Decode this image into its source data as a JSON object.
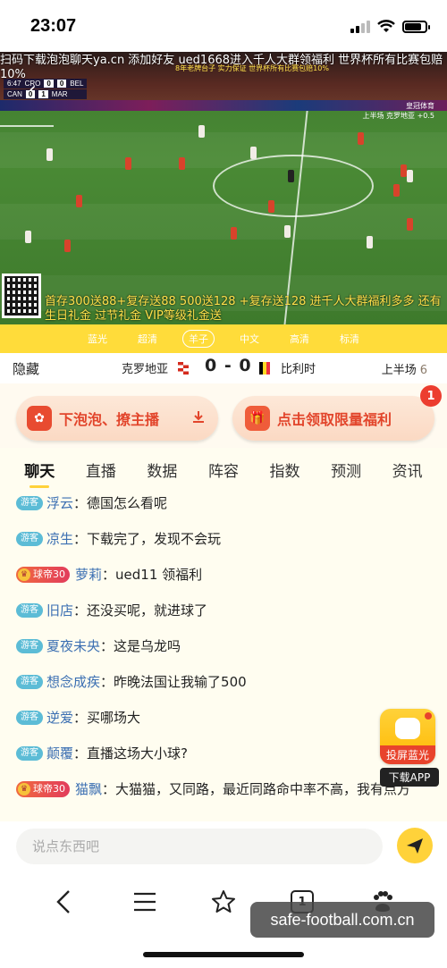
{
  "status_bar": {
    "time": "23:07"
  },
  "video": {
    "marquee": "扫码下载泡泡聊天ya.cn 添加好友 ued1668进入千人大群领福利 世界杯所有比赛包赔10%",
    "score_rows": [
      {
        "clock": "6:47",
        "home": "CRO",
        "home_score": "0",
        "away_score": "0",
        "away": "BEL"
      },
      {
        "clock": "",
        "home": "CAN",
        "home_score": "0",
        "away_score": "1",
        "away": "MAR"
      }
    ],
    "promo_top": "8年老牌台子 实力保证 世界杯所有比赛包赔10%",
    "promo_right_1": "皇冠体育",
    "promo_right_2": "上半场 克罗地亚 +0.5",
    "promo_bottom": "首存300送88+复存送88 500送128 +复存送128 进千人大群福利多多 还有生日礼金 过节礼金 VIP等级礼金送"
  },
  "quality_options": [
    "蓝光",
    "超清",
    "羊子",
    "中文",
    "高清",
    "标清"
  ],
  "quality_active": 2,
  "match": {
    "hide_label": "隐藏",
    "home": "克罗地亚",
    "away": "比利时",
    "score": "0 - 0",
    "period": "上半场",
    "minute": "6"
  },
  "actions": {
    "download_label": "下泡泡、撩主播",
    "welfare_label": "点击领取限量福利",
    "welfare_badge": "1"
  },
  "tabs": [
    "聊天",
    "直播",
    "数据",
    "阵容",
    "指数",
    "预测",
    "资讯"
  ],
  "guest_badge": "游客",
  "vip_badge": "球帝30",
  "messages": [
    {
      "type": "guest",
      "user": "浮云",
      "text": "德国怎么看呢"
    },
    {
      "type": "guest",
      "user": "凉生",
      "text": "下载完了，发现不会玩"
    },
    {
      "type": "vip",
      "user": "萝莉",
      "text": "ued11 领福利"
    },
    {
      "type": "guest",
      "user": "旧店",
      "text": "还没买呢，就进球了"
    },
    {
      "type": "guest",
      "user": "夏夜未央",
      "text": "这是乌龙吗"
    },
    {
      "type": "guest",
      "user": "想念成疾",
      "text": "昨晚法国让我输了500"
    },
    {
      "type": "guest",
      "user": "逆爱",
      "text": "买哪场大"
    },
    {
      "type": "guest",
      "user": "颠覆",
      "text": "直播这场大小球?"
    },
    {
      "type": "vip",
      "user": "猫飘",
      "text": "大猫猫，又同路，最近同路命中率不高，我有点方"
    }
  ],
  "float_app": {
    "label": "投屏蓝光",
    "download": "下载APP"
  },
  "input": {
    "placeholder": "说点东西吧"
  },
  "bottom_nav": {
    "tab_count": "1"
  },
  "watermark": "safe-football.com.cn",
  "colors": {
    "accent": "#ffd23a",
    "promo_red": "#e2452b",
    "username": "#3b6fb2",
    "guest": "#5cbcd6"
  }
}
